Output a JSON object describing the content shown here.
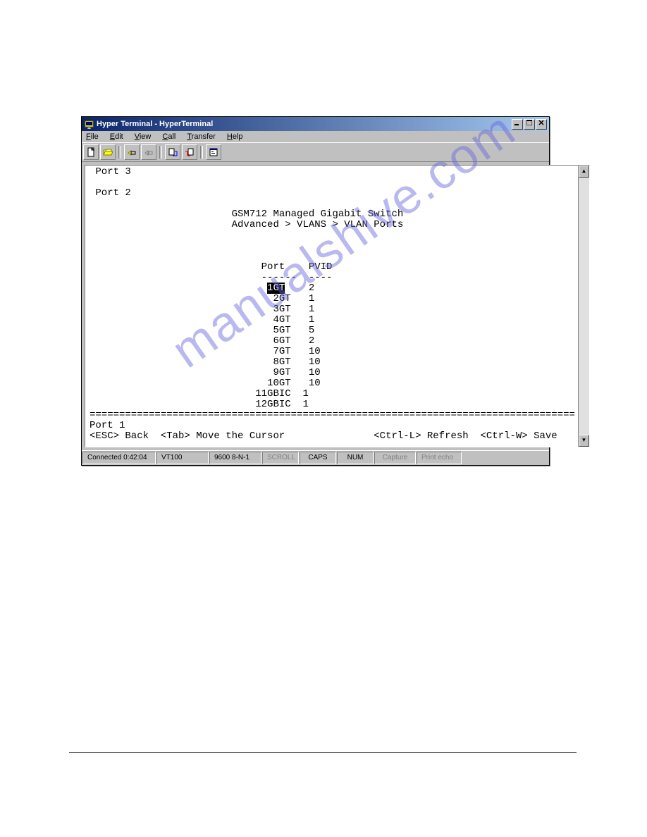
{
  "window": {
    "title": "Hyper Terminal - HyperTerminal"
  },
  "menu": {
    "file": "File",
    "edit": "Edit",
    "view": "View",
    "call": "Call",
    "transfer": "Transfer",
    "help": "Help"
  },
  "terminal": {
    "port3": " Port 3",
    "blank1": "",
    "port2": " Port 2",
    "blank2": "",
    "title1": "                        GSM712 Managed Gigabit Switch",
    "title2": "                        Advanced > VLANS > VLAN Ports",
    "blank3": "",
    "blank4": "",
    "blank5": "",
    "header": "                             Port    PVID",
    "dashes": "                             ------  ----",
    "rows": [
      {
        "prefix": "                              ",
        "port": "1GT",
        "pvid": "    2",
        "selected": true
      },
      {
        "prefix": "                               ",
        "port": "2GT",
        "pvid": "   1",
        "selected": false
      },
      {
        "prefix": "                               ",
        "port": "3GT",
        "pvid": "   1",
        "selected": false
      },
      {
        "prefix": "                               ",
        "port": "4GT",
        "pvid": "   1",
        "selected": false
      },
      {
        "prefix": "                               ",
        "port": "5GT",
        "pvid": "   5",
        "selected": false
      },
      {
        "prefix": "                               ",
        "port": "6GT",
        "pvid": "   2",
        "selected": false
      },
      {
        "prefix": "                               ",
        "port": "7GT",
        "pvid": "   10",
        "selected": false
      },
      {
        "prefix": "                               ",
        "port": "8GT",
        "pvid": "   10",
        "selected": false
      },
      {
        "prefix": "                               ",
        "port": "9GT",
        "pvid": "   10",
        "selected": false
      },
      {
        "prefix": "                              ",
        "port": "10GT",
        "pvid": "   10",
        "selected": false
      },
      {
        "prefix": "                            ",
        "port": "11GBIC",
        "pvid": "  1",
        "selected": false
      },
      {
        "prefix": "                            ",
        "port": "12GBIC",
        "pvid": "  1",
        "selected": false
      }
    ],
    "divider": "==================================================================================",
    "port1": "Port 1",
    "help": "<ESC> Back  <Tab> Move the Cursor               <Ctrl-L> Refresh  <Ctrl-W> Save"
  },
  "statusbar": {
    "connected": "Connected 0:42:04",
    "emulation": "VT100",
    "params": "9600 8-N-1",
    "scroll": "SCROLL",
    "caps": "CAPS",
    "num": "NUM",
    "capture": "Capture",
    "printecho": "Print echo"
  },
  "watermark": "manualshive.com"
}
